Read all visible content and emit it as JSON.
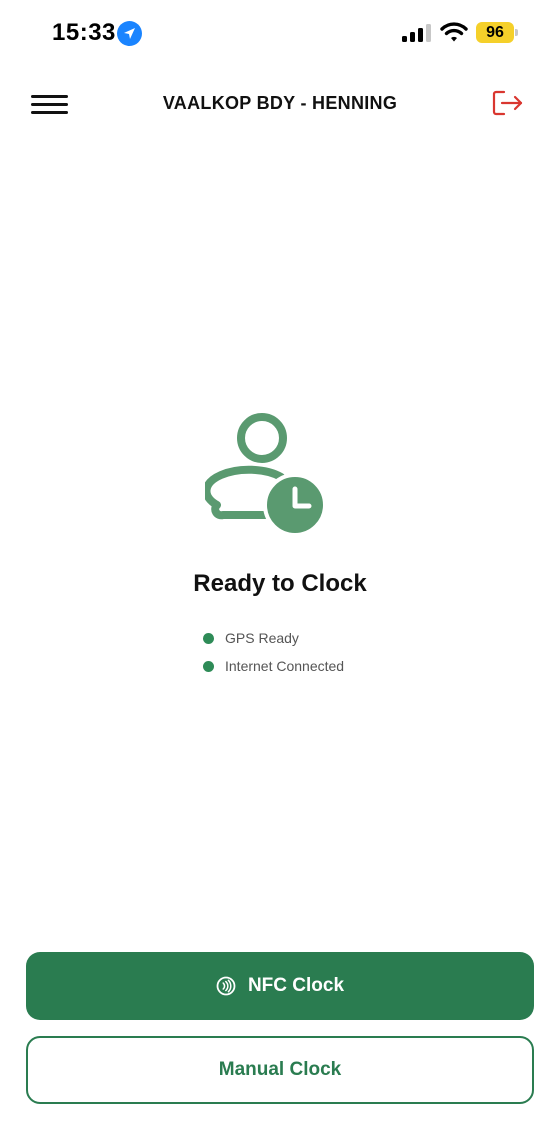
{
  "status_bar": {
    "time": "15:33",
    "battery": "96",
    "icons": [
      "location-arrow-icon",
      "signal-icon",
      "wifi-icon",
      "battery-icon"
    ]
  },
  "header": {
    "title": "VAALKOP BDY - HENNING",
    "menu_icon": "hamburger-menu-icon",
    "logout_icon": "logout-icon"
  },
  "main": {
    "icon": "person-clock-icon",
    "status_title": "Ready to Clock",
    "checks": [
      {
        "label": "GPS Ready",
        "color": "#2e8b57"
      },
      {
        "label": "Internet Connected",
        "color": "#2e8b57"
      }
    ]
  },
  "actions": {
    "nfc_label": "NFC Clock",
    "nfc_icon": "nfc-icon",
    "manual_label": "Manual Clock"
  },
  "colors": {
    "primary": "#2a7c50",
    "icon_green": "#5a9a70",
    "logout_red": "#d9362f",
    "battery_yellow": "#f5d02a",
    "location_blue": "#1a84ff"
  }
}
